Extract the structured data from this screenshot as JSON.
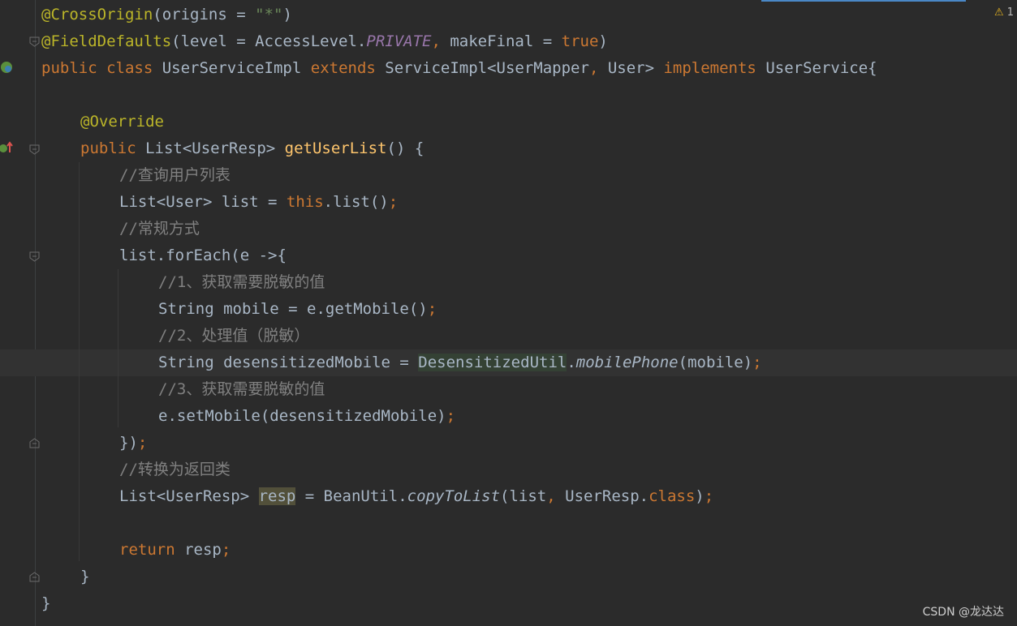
{
  "editor": {
    "warning_count": "1",
    "lines": [
      {
        "indent": 0,
        "tokens": [
          {
            "t": "@CrossOrigin",
            "c": "ann"
          },
          {
            "t": "(origins = "
          },
          {
            "t": "\"*\"",
            "c": "str"
          },
          {
            "t": ")"
          }
        ]
      },
      {
        "indent": 0,
        "tokens": [
          {
            "t": "@FieldDefaults",
            "c": "ann"
          },
          {
            "t": "(level = AccessLevel."
          },
          {
            "t": "PRIVATE",
            "c": "const"
          },
          {
            "t": ", ",
            "c": "punc"
          },
          {
            "t": "makeFinal = "
          },
          {
            "t": "true",
            "c": "kw"
          },
          {
            "t": ")"
          }
        ]
      },
      {
        "indent": 0,
        "tokens": [
          {
            "t": "public class ",
            "c": "kw"
          },
          {
            "t": "UserServiceImpl "
          },
          {
            "t": "extends ",
            "c": "kw"
          },
          {
            "t": "ServiceImpl<UserMapper"
          },
          {
            "t": ", ",
            "c": "punc"
          },
          {
            "t": "User> "
          },
          {
            "t": "implements ",
            "c": "kw"
          },
          {
            "t": "UserService{"
          }
        ]
      },
      {
        "indent": 0,
        "tokens": []
      },
      {
        "indent": 1,
        "tokens": [
          {
            "t": "@Override",
            "c": "ann"
          }
        ]
      },
      {
        "indent": 1,
        "tokens": [
          {
            "t": "public ",
            "c": "kw"
          },
          {
            "t": "List<UserResp> "
          },
          {
            "t": "getUserList",
            "c": "fn"
          },
          {
            "t": "() {"
          }
        ]
      },
      {
        "indent": 2,
        "tokens": [
          {
            "t": "//查询用户列表",
            "c": "cm"
          }
        ]
      },
      {
        "indent": 2,
        "tokens": [
          {
            "t": "List<User> list = "
          },
          {
            "t": "this",
            "c": "kw"
          },
          {
            "t": ".list()"
          },
          {
            "t": ";",
            "c": "punc"
          }
        ]
      },
      {
        "indent": 2,
        "tokens": [
          {
            "t": "//常规方式",
            "c": "cm"
          }
        ]
      },
      {
        "indent": 2,
        "tokens": [
          {
            "t": "list.forEach(e ->{"
          }
        ]
      },
      {
        "indent": 3,
        "tokens": [
          {
            "t": "//1、获取需要脱敏的值",
            "c": "cm"
          }
        ]
      },
      {
        "indent": 3,
        "tokens": [
          {
            "t": "String mobile = e.getMobile()"
          },
          {
            "t": ";",
            "c": "punc"
          }
        ]
      },
      {
        "indent": 3,
        "tokens": [
          {
            "t": "//2、处理值（脱敏）",
            "c": "cm"
          }
        ]
      },
      {
        "indent": 3,
        "current": true,
        "tokens": [
          {
            "t": "String desensitizedMobile = "
          },
          {
            "t": "DesensitizedUtil",
            "c": "hl-green"
          },
          {
            "t": "."
          },
          {
            "t": "mobilePhone",
            "c": "static-call"
          },
          {
            "t": "(mobile)"
          },
          {
            "t": ";",
            "c": "punc"
          }
        ]
      },
      {
        "indent": 3,
        "tokens": [
          {
            "t": "//3、获取需要脱敏的值",
            "c": "cm"
          }
        ]
      },
      {
        "indent": 3,
        "tokens": [
          {
            "t": "e.setMobile(desensitizedMobile)"
          },
          {
            "t": ";",
            "c": "punc"
          }
        ]
      },
      {
        "indent": 2,
        "tokens": [
          {
            "t": "})"
          },
          {
            "t": ";",
            "c": "punc"
          }
        ]
      },
      {
        "indent": 2,
        "tokens": [
          {
            "t": "//转换为返回类",
            "c": "cm"
          }
        ]
      },
      {
        "indent": 2,
        "tokens": [
          {
            "t": "List<UserResp> "
          },
          {
            "t": "resp",
            "c": "hl-olive"
          },
          {
            "t": " = BeanUtil."
          },
          {
            "t": "copyToList",
            "c": "static-call"
          },
          {
            "t": "(list"
          },
          {
            "t": ", ",
            "c": "punc"
          },
          {
            "t": "UserResp."
          },
          {
            "t": "class",
            "c": "kw"
          },
          {
            "t": ")"
          },
          {
            "t": ";",
            "c": "punc"
          }
        ]
      },
      {
        "indent": 2,
        "tokens": []
      },
      {
        "indent": 2,
        "tokens": [
          {
            "t": "return ",
            "c": "kw"
          },
          {
            "t": "resp"
          },
          {
            "t": ";",
            "c": "punc"
          }
        ]
      },
      {
        "indent": 1,
        "tokens": [
          {
            "t": "}"
          }
        ]
      },
      {
        "indent": 0,
        "tokens": [
          {
            "t": "}"
          }
        ]
      }
    ]
  },
  "gutter_icons": [
    {
      "name": "bean-class-icon"
    },
    {
      "name": "implementing-method-icon"
    }
  ],
  "colors": {
    "background": "#2b2b2b",
    "annotation": "#bbb529",
    "keyword": "#cc7832",
    "string": "#6a8759",
    "comment": "#808080",
    "constant": "#9876aa",
    "method_decl": "#ffc66d",
    "text": "#a9b7c6"
  },
  "watermark": "CSDN @龙达达"
}
